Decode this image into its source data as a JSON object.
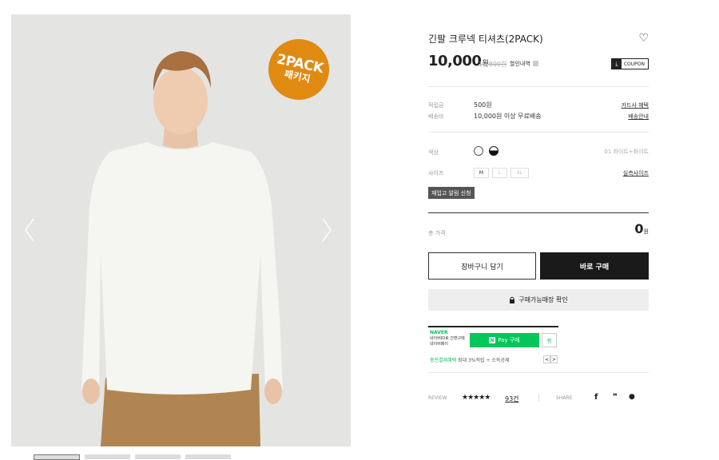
{
  "product": {
    "title": "긴팔 크루넥 티셔츠(2PACK)",
    "price": "10,000",
    "price_unit": "원",
    "original_price": "16,800원",
    "discount_label": "할인내역",
    "coupon_label": "COUPON",
    "badge_line1": "2PACK",
    "badge_line2": "패키지"
  },
  "details": {
    "points_label": "적립금",
    "points_value": "500원",
    "card_benefit_link": "카드사 혜택",
    "shipping_label": "배송비",
    "shipping_value": "10,000원 이상 무료배송",
    "shipping_info_link": "배송안내"
  },
  "options": {
    "color_label": "색상",
    "color_selected": "01 화이트+화이트",
    "colors": [
      "#ffffff",
      "#111111"
    ],
    "size_label": "사이즈",
    "sizes": [
      "M",
      "L",
      "XL"
    ],
    "size_guide_link": "실측사이즈",
    "restock_label": "재입고 알림 신청"
  },
  "total": {
    "label": "총 가격",
    "value": "0",
    "unit": "원"
  },
  "actions": {
    "cart_label": "장바구니 담기",
    "buy_label": "바로 구매",
    "store_check_label": "구매가능매장 확인"
  },
  "naver": {
    "logo": "NAVER",
    "line1": "네이버ID로 간편구매",
    "line2": "네이버페이",
    "pay_n": "N",
    "pay_label": "Pay 구매",
    "wish_label": "찜",
    "benefit_green": "충전결제혜택",
    "benefit_rest": "최대 3%적립 + 소득공제",
    "prev": "<",
    "next": ">"
  },
  "review": {
    "label": "REVIEW",
    "stars": "★★★★★",
    "count": "93건",
    "share_label": "SHARE",
    "share_icons": [
      "f",
      "❞",
      "●"
    ]
  }
}
